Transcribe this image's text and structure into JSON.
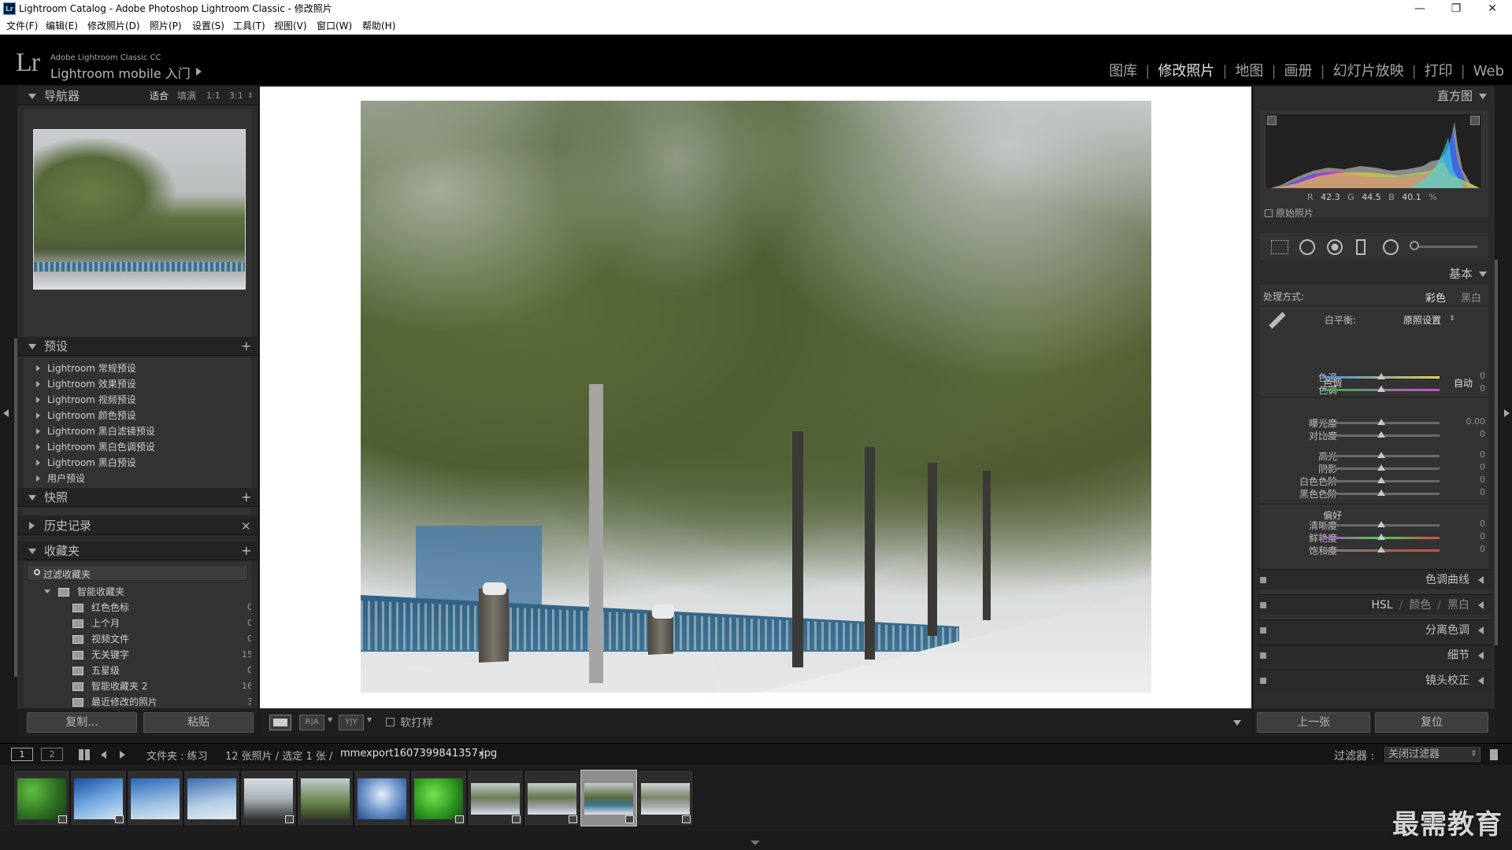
{
  "titlebar": {
    "title": "Lightroom Catalog - Adobe Photoshop Lightroom Classic - 修改照片",
    "minimize": "—",
    "restore": "❐",
    "close": "✕",
    "app_icon": "Lr"
  },
  "menu": [
    {
      "label": "文件(F)"
    },
    {
      "label": "编辑(E)"
    },
    {
      "label": "修改照片(D)"
    },
    {
      "label": "照片(P)"
    },
    {
      "label": "设置(S)"
    },
    {
      "label": "工具(T)"
    },
    {
      "label": "视图(V)"
    },
    {
      "label": "窗口(W)"
    },
    {
      "label": "帮助(H)"
    }
  ],
  "identity": {
    "logo": "Lr",
    "cc_label": "Adobe Lightroom Classic CC",
    "mobile_label": "Lightroom mobile 入门"
  },
  "modules": [
    {
      "label": "图库",
      "active": false
    },
    {
      "label": "修改照片",
      "active": true
    },
    {
      "label": "地图",
      "active": false
    },
    {
      "label": "画册",
      "active": false
    },
    {
      "label": "幻灯片放映",
      "active": false
    },
    {
      "label": "打印",
      "active": false
    },
    {
      "label": "Web",
      "active": false
    }
  ],
  "navigator": {
    "title": "导航器",
    "zoom": [
      "适合",
      "填满",
      "1:1",
      "3:1"
    ]
  },
  "presets": {
    "title": "预设",
    "add": "+",
    "items": [
      {
        "label": "Lightroom 常规预设"
      },
      {
        "label": "Lightroom 效果预设"
      },
      {
        "label": "Lightroom 视频预设"
      },
      {
        "label": "Lightroom 颜色预设"
      },
      {
        "label": "Lightroom 黑白滤镜预设"
      },
      {
        "label": "Lightroom 黑白色调预设"
      },
      {
        "label": "Lightroom 黑白预设"
      },
      {
        "label": "用户预设"
      }
    ]
  },
  "snapshots": {
    "title": "快照",
    "add": "+"
  },
  "history": {
    "title": "历史记录",
    "clear": "×"
  },
  "collections": {
    "title": "收藏夹",
    "add": "+",
    "filter": "过滤收藏夹",
    "smart_group": "智能收藏夹",
    "items": [
      {
        "label": "红色色标",
        "count": "0"
      },
      {
        "label": "上个月",
        "count": "0"
      },
      {
        "label": "视频文件",
        "count": "0"
      },
      {
        "label": "无关键字",
        "count": "15"
      },
      {
        "label": "五星级",
        "count": "0"
      },
      {
        "label": "智能收藏夹 2",
        "count": "16"
      },
      {
        "label": "最近修改的照片",
        "count": "3"
      }
    ]
  },
  "left_buttons": {
    "copy": "复制...",
    "paste": "粘贴"
  },
  "histogram": {
    "title": "直方图",
    "r_label": "R",
    "r": "42.3",
    "g_label": "G",
    "g": "44.5",
    "b_label": "B",
    "b": "40.1",
    "unit": "%",
    "original": "原始照片"
  },
  "basic": {
    "title": "基本",
    "process_label": "处理方式:",
    "color": "彩色",
    "bw": "黑白",
    "wb_label": "白平衡:",
    "wb_value": "原照设置",
    "tone_label": "色调",
    "auto": "自动",
    "presence_label": "偏好",
    "sliders": [
      {
        "name": "色温",
        "value": "0",
        "pos": 0.5
      },
      {
        "name": "色调",
        "value": "0",
        "pos": 0.5
      },
      {
        "name": "曝光度",
        "value": "0.00",
        "pos": 0.5
      },
      {
        "name": "对比度",
        "value": "0",
        "pos": 0.5
      },
      {
        "name": "高光",
        "value": "0",
        "pos": 0.5
      },
      {
        "name": "阴影",
        "value": "0",
        "pos": 0.5
      },
      {
        "name": "白色色阶",
        "value": "0",
        "pos": 0.5
      },
      {
        "name": "黑色色阶",
        "value": "0",
        "pos": 0.5
      },
      {
        "name": "清晰度",
        "value": "0",
        "pos": 0.5
      },
      {
        "name": "鲜艳度",
        "value": "0",
        "pos": 0.5
      },
      {
        "name": "饱和度",
        "value": "0",
        "pos": 0.5
      }
    ]
  },
  "sections": {
    "tone_curve": "色调曲线",
    "hsl": "HSL",
    "hsl_color": "颜色",
    "hsl_bw": "黑白",
    "split": "分离色调",
    "detail": "细节",
    "lens": "镜头校正",
    "sep": "/"
  },
  "right_buttons": {
    "previous": "上一张",
    "reset": "复位"
  },
  "toolbar": {
    "soft_proof": "软打样",
    "ba1": "R|A",
    "ba2": "Y|Y"
  },
  "filmbar": {
    "screen1": "1",
    "screen2": "2",
    "source": "文件夹 : 练习",
    "count": "12 张照片 / 选定 1 张 /",
    "filename": "mmexport1607399841357.jpg",
    "filter_label": "过滤器 :",
    "filter_value": "关闭过滤器"
  },
  "watermark": "最需教育",
  "colors": {
    "accent_active": "#e4e4e4",
    "panel": "#2c2c2c",
    "filmstrip": "#1e1e1e",
    "background": "#1b1b1b"
  }
}
